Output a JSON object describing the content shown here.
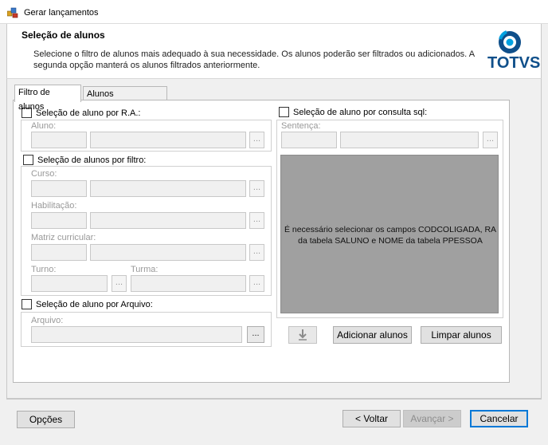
{
  "window": {
    "title": "Gerar lançamentos"
  },
  "header": {
    "title": "Seleção de alunos",
    "description_line1": "Selecione o filtro de alunos mais adequado à sua necessidade. Os alunos poderão ser filtrados ou adicionados. A",
    "description_line2": "segunda opção manterá os alunos filtrados anteriormente.",
    "logo_text": "TOTVS"
  },
  "tabs": [
    {
      "label": "Filtro de alunos",
      "active": true
    },
    {
      "label": "Alunos selecionados",
      "active": false
    }
  ],
  "ra_section": {
    "checkbox_label": "Seleção de aluno por R.A.:",
    "checked": false,
    "field_label": "Aluno:",
    "lookup_glyph": "..."
  },
  "filter_section": {
    "checkbox_label": "Seleção de alunos por filtro:",
    "checked": false,
    "curso_label": "Curso:",
    "habilitacao_label": "Habilitação:",
    "matriz_label": "Matriz curricular:",
    "turno_label": "Turno:",
    "turma_label": "Turma:",
    "lookup_glyph": "..."
  },
  "file_section": {
    "checkbox_label": "Seleção de aluno por Arquivo:",
    "checked": false,
    "field_label": "Arquivo:",
    "browse_glyph": "..."
  },
  "sql_section": {
    "checkbox_label": "Seleção de aluno por consulta sql:",
    "checked": false,
    "field_label": "Sentença:",
    "lookup_glyph": "...",
    "message_line1": "É necessário selecionar os campos CODCOLIGADA, RA",
    "message_line2": "da tabela SALUNO e NOME da tabela PPESSOA"
  },
  "actions": {
    "import_icon": "down-arrow-import-icon",
    "add_label": "Adicionar alunos",
    "clear_label": "Limpar alunos"
  },
  "footer": {
    "options_label": "Opções",
    "back_label": "< Voltar",
    "next_label": "Avançar >",
    "cancel_label": "Cancelar"
  },
  "colors": {
    "brand": "#0f4f8a",
    "logo_accent": "#00a1e0",
    "primary_border": "#0078d7",
    "disabled_area": "#a0a0a0"
  }
}
